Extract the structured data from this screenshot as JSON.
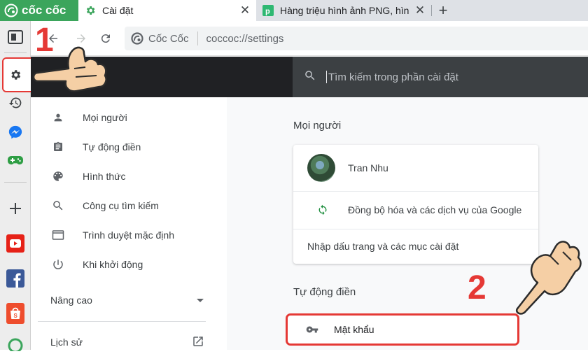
{
  "colors": {
    "brand_green": "#3ba55c",
    "accent_red": "#e53935",
    "header_dark": "#202124",
    "search_dark": "#3c4043",
    "sync_green": "#1e8e3e"
  },
  "browser": {
    "logo_text": "cốc cốc",
    "tabs": [
      {
        "title": "Cài đặt",
        "icon": "gear-icon",
        "active": true,
        "close": "✕"
      },
      {
        "title": "Hàng triệu hình ảnh PNG, hìn",
        "icon": "pngtree-icon",
        "active": false,
        "close": "✕"
      }
    ],
    "new_tab": "+",
    "site_chip": "Cốc Cốc",
    "url": "coccoc://settings"
  },
  "sidebar": {
    "items": [
      {
        "name": "sidebar-toggle",
        "icon": "panel-icon"
      },
      {
        "name": "settings",
        "icon": "gear-icon"
      },
      {
        "name": "history",
        "icon": "history-icon"
      },
      {
        "name": "messenger",
        "icon": "messenger-icon"
      },
      {
        "name": "games",
        "icon": "gamepad-icon"
      },
      {
        "name": "add",
        "icon": "plus-icon"
      },
      {
        "name": "youtube",
        "icon": "youtube-icon"
      },
      {
        "name": "facebook",
        "icon": "facebook-icon"
      },
      {
        "name": "shopee",
        "icon": "shopee-icon"
      }
    ]
  },
  "settings": {
    "search_placeholder": "Tìm kiếm trong phần cài đặt",
    "nav": [
      {
        "label": "Mọi người",
        "icon": "person-icon"
      },
      {
        "label": "Tự động điền",
        "icon": "clipboard-icon"
      },
      {
        "label": "Hình thức",
        "icon": "palette-icon"
      },
      {
        "label": "Công cụ tìm kiếm",
        "icon": "search-icon"
      },
      {
        "label": "Trình duyệt mặc định",
        "icon": "browser-window-icon"
      },
      {
        "label": "Khi khởi động",
        "icon": "power-icon"
      }
    ],
    "advanced_label": "Nâng cao",
    "history_label": "Lịch sử",
    "people_section_title": "Mọi người",
    "profile_name": "Tran Nhu",
    "sync_label": "Đồng bộ hóa và các dịch vụ của Google",
    "import_label": "Nhập dấu trang và các mục cài đặt",
    "autofill_section_title": "Tự động điền",
    "password_label": "Mật khẩu"
  },
  "annotations": {
    "step1": "1",
    "step2": "2"
  }
}
